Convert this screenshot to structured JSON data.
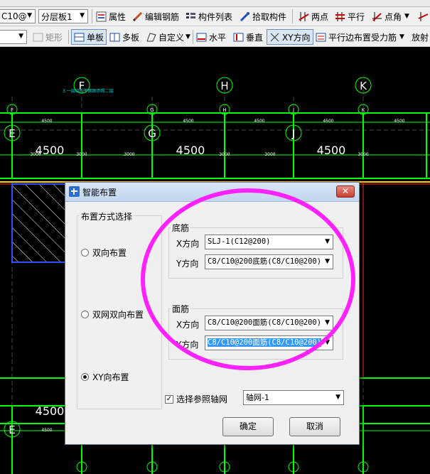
{
  "toolbar1": {
    "rebar_combo": "C10@",
    "layer_combo": "分层板1",
    "properties": "属性",
    "edit_rebar": "编辑钢筋",
    "component_list": "构件列表",
    "pick_component": "拾取构件",
    "two_points": "两点",
    "parallel": "平行",
    "point_angle": "点角"
  },
  "toolbar2": {
    "rect": "矩形",
    "single_board": "单板",
    "multi_board": "多板",
    "custom": "自定义",
    "horizontal": "水平",
    "vertical": "垂直",
    "xy_direction": "XY方向",
    "parallel_edge": "平行边布置受力筋",
    "radial": "放射"
  },
  "cad": {
    "axis_labels_top": [
      "F",
      "H",
      "K"
    ],
    "axis_labels_row": [
      "F",
      "G",
      "H",
      "J",
      "K"
    ],
    "axis_labels_mid": [
      "E",
      "G",
      "J"
    ],
    "dims_big": [
      "4500",
      "4500",
      "4500",
      "4500"
    ],
    "dims_small": [
      "3000",
      "3000",
      "3000",
      "3000",
      "3000",
      "3000"
    ],
    "dims_small_top": [
      "4500",
      "4500",
      "4500",
      "4500",
      "4500"
    ],
    "note": "3.一层结构平面图参照二层",
    "axis_bottom_left": "E",
    "dim_bottom": "4500"
  },
  "dialog": {
    "title": "智能布置",
    "layout_group": "布置方式选择",
    "radio_bidirectional": "双向布置",
    "radio_double_net": "双网双向布置",
    "radio_xy": "XY向布置",
    "bottom_group": "底筋",
    "top_group": "面筋",
    "x_dir": "X方向",
    "y_dir": "Y方向",
    "bottom_x_value": "SLJ-1(C12@200)",
    "bottom_y_value": "C8/C10@200底筋(C8/C10@200)",
    "top_x_value": "C8/C10@200面筋(C8/C10@200)",
    "top_y_value": "C8/C10@200面筋(C8/C10@200)",
    "ref_grid_check": "选择参照轴网",
    "grid_value": "轴网-1",
    "ok": "确定",
    "cancel": "取消",
    "close_glyph": "✕"
  },
  "colors": {
    "cad_bg": "#000000",
    "grid_green": "#00ff00",
    "annotation_magenta": "#ff22ff",
    "dialog_bg": "#f0f0f0",
    "selection_blue": "#3399ff"
  }
}
